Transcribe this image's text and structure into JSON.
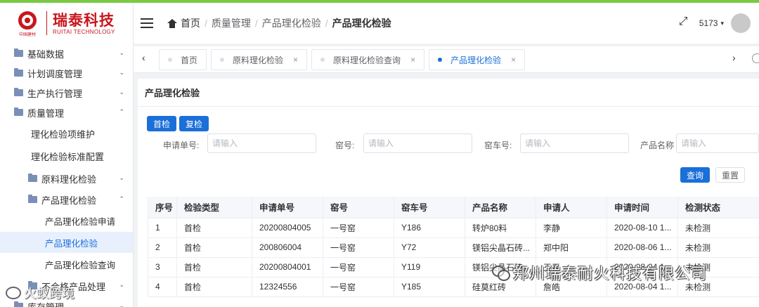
{
  "brand": {
    "name_cn": "瑞泰科技",
    "name_en": "RUITAI TECHNOLOGY",
    "mark_sub": "中国建材"
  },
  "sidebar": {
    "items": [
      {
        "label": "基础数据",
        "arrow": "⌄"
      },
      {
        "label": "计划调度管理",
        "arrow": "⌄"
      },
      {
        "label": "生产执行管理",
        "arrow": "⌄"
      },
      {
        "label": "质量管理",
        "arrow": "⌃"
      }
    ],
    "quality_children": [
      {
        "label": "理化检验项维护"
      },
      {
        "label": "理化检验标准配置"
      }
    ],
    "raw_group": {
      "label": "原料理化检验",
      "arrow": "⌄"
    },
    "product_group": {
      "label": "产品理化检验",
      "arrow": "⌃"
    },
    "product_children": [
      {
        "label": "产品理化检验申请"
      },
      {
        "label": "产品理化检验"
      },
      {
        "label": "产品理化检验查询"
      }
    ],
    "more": [
      {
        "label": "不合格产品处理",
        "arrow": "⌄"
      },
      {
        "label": "库存管理",
        "arrow": "⌄"
      }
    ]
  },
  "header": {
    "breadcrumb": [
      "首页",
      "质量管理",
      "产品理化检验",
      "产品理化检验"
    ],
    "user": "5173",
    "caret": "▾"
  },
  "tabs": [
    {
      "label": "首页",
      "closable": false
    },
    {
      "label": "原料理化检验",
      "closable": true
    },
    {
      "label": "原料理化检验查询",
      "closable": true
    },
    {
      "label": "产品理化检验",
      "closable": true
    }
  ],
  "tab_close": "×",
  "tab_prev": "‹",
  "tab_next": "›",
  "panel": {
    "title": "产品理化检验",
    "btn_first": "首检",
    "btn_recheck": "复检",
    "filters": [
      {
        "label": "申请单号:",
        "placeholder": "请输入"
      },
      {
        "label": "窑号:",
        "placeholder": "请输入"
      },
      {
        "label": "窑车号:",
        "placeholder": "请输入"
      },
      {
        "label": "产品名称",
        "placeholder": "请输入"
      }
    ],
    "btn_query": "查询",
    "btn_reset": "重置"
  },
  "table": {
    "columns": [
      "序号",
      "检验类型",
      "申请单号",
      "窑号",
      "窑车号",
      "产品名称",
      "申请人",
      "申请时间",
      "检测状态"
    ],
    "rows": [
      [
        "1",
        "首检",
        "20200804005",
        "一号窑",
        "Y186",
        "转炉80料",
        "李静",
        "2020-08-10 1...",
        "未检测"
      ],
      [
        "2",
        "首检",
        "200806004",
        "一号窑",
        "Y72",
        "镁铝尖晶石砖...",
        "郑中阳",
        "2020-08-06 1...",
        "未检测"
      ],
      [
        "3",
        "首检",
        "20200804001",
        "一号窑",
        "Y119",
        "镁铝尖晶石砖",
        "王平",
        "2020-08-04 1...",
        "未检测"
      ],
      [
        "4",
        "首检",
        "12324556",
        "一号窑",
        "Y185",
        "硅莫红砖",
        "詹皓",
        "2020-08-04 1...",
        "未检测"
      ]
    ]
  },
  "watermarks": {
    "main": "郑州瑞泰耐火科技有限公司",
    "left": "火蚁跨境"
  }
}
